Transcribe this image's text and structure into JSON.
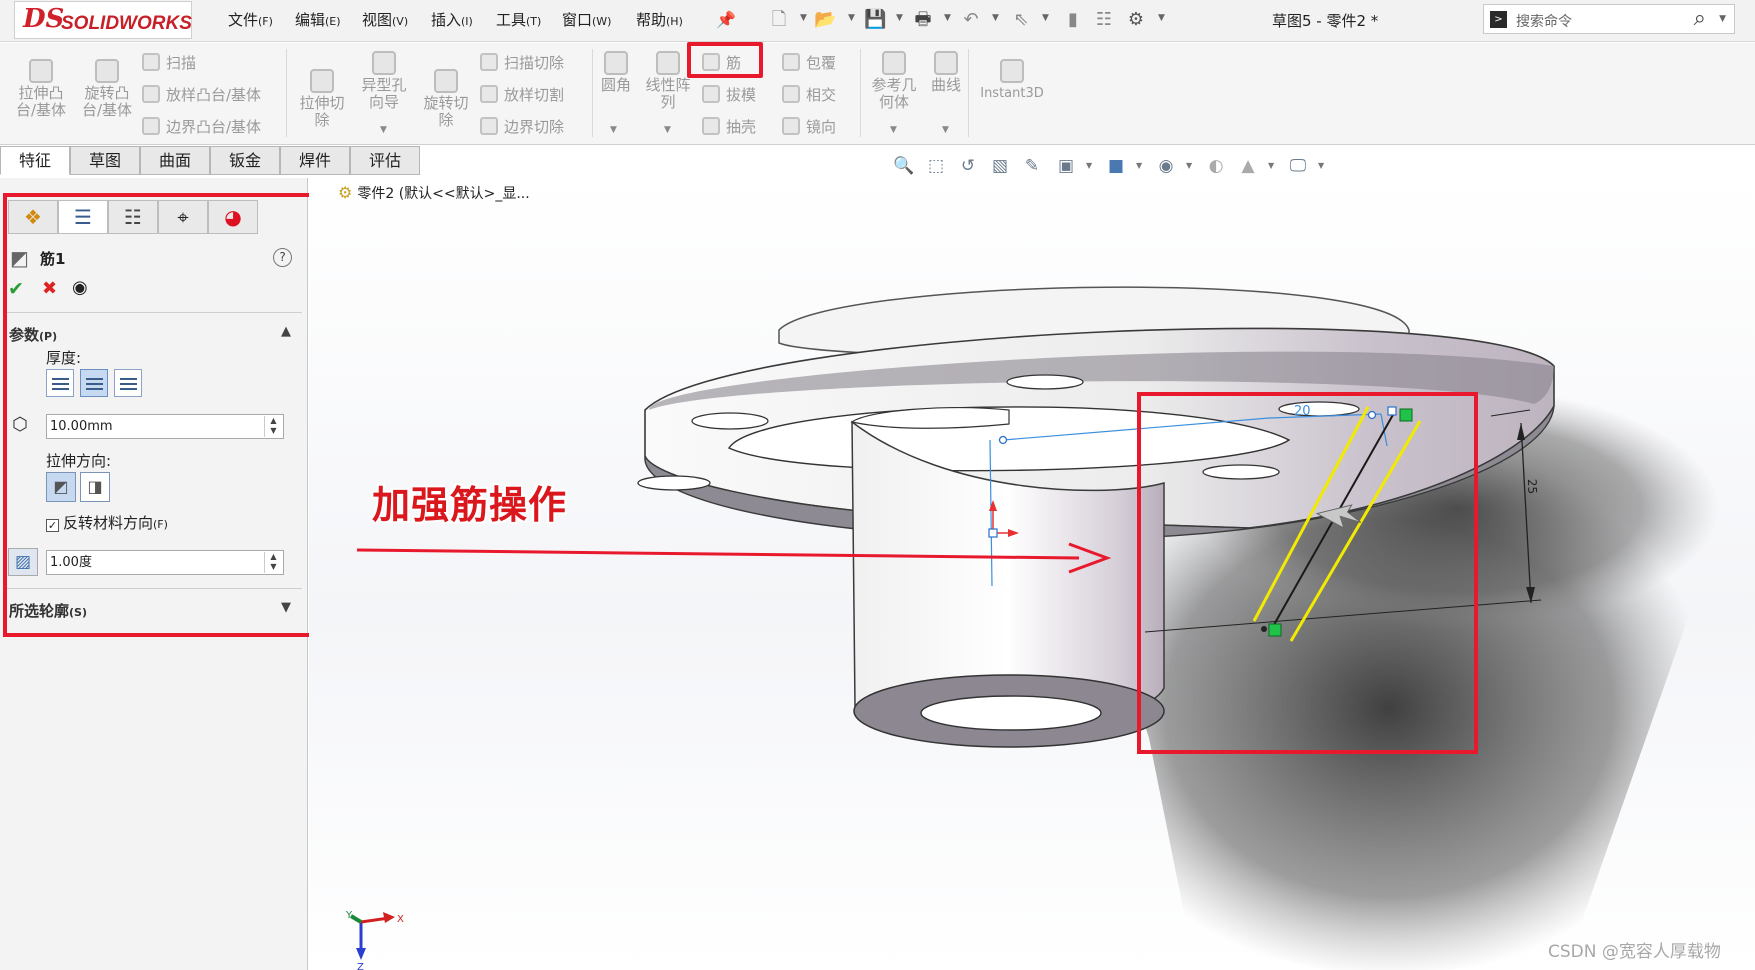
{
  "app": {
    "logo_text": "SOLIDWORKS",
    "logo_mark": "DS",
    "document_title": "草图5 - 零件2 *",
    "search_placeholder": "搜索命令"
  },
  "menu": [
    {
      "label": "文件",
      "hotkey": "(F)"
    },
    {
      "label": "编辑",
      "hotkey": "(E)"
    },
    {
      "label": "视图",
      "hotkey": "(V)"
    },
    {
      "label": "插入",
      "hotkey": "(I)"
    },
    {
      "label": "工具",
      "hotkey": "(T)"
    },
    {
      "label": "窗口",
      "hotkey": "(W)"
    },
    {
      "label": "帮助",
      "hotkey": "(H)"
    }
  ],
  "ribbon": {
    "extrude_boss": "拉伸凸\n台/基体",
    "revolve_boss": "旋转凸\n台/基体",
    "sweep": "扫描",
    "loft": "放样凸台/基体",
    "boundary": "边界凸台/基体",
    "extrude_cut": "拉伸切\n除",
    "hole_wizard": "异型孔\n向导",
    "revolve_cut": "旋转切\n除",
    "sweep_cut": "扫描切除",
    "loft_cut": "放样切割",
    "boundary_cut": "边界切除",
    "fillet": "圆角",
    "linear_pattern": "线性阵\n列",
    "rib": "筋",
    "draft": "拔模",
    "shell": "抽壳",
    "wrap": "包覆",
    "intersect": "相交",
    "mirror": "镜向",
    "ref_geometry": "参考几\n何体",
    "curves": "曲线",
    "instant3d": "Instant3D"
  },
  "tabs": [
    "特征",
    "草图",
    "曲面",
    "钣金",
    "焊件",
    "评估"
  ],
  "property_manager": {
    "title": "筋1",
    "params_header": "参数",
    "params_hotkey": "(P)",
    "thickness_label": "厚度:",
    "thickness_value": "10.00mm",
    "extrude_dir_label": "拉伸方向:",
    "flip_label": "反转材料方向",
    "flip_hotkey": "(F)",
    "flip_checked": true,
    "draft_value": "1.00度",
    "contours_header": "所选轮廓",
    "contours_hotkey": "(S)"
  },
  "viewport": {
    "tree_item": "零件2 (默认<<默认>_显...",
    "dimension_width": "20",
    "dimension_height": "25",
    "annotation": "加强筋操作"
  },
  "watermark": "CSDN @宽容人厚载物",
  "colors": {
    "highlight": "#e8192c",
    "rib_line": "#f0f000",
    "brand_red": "#d0212b"
  }
}
